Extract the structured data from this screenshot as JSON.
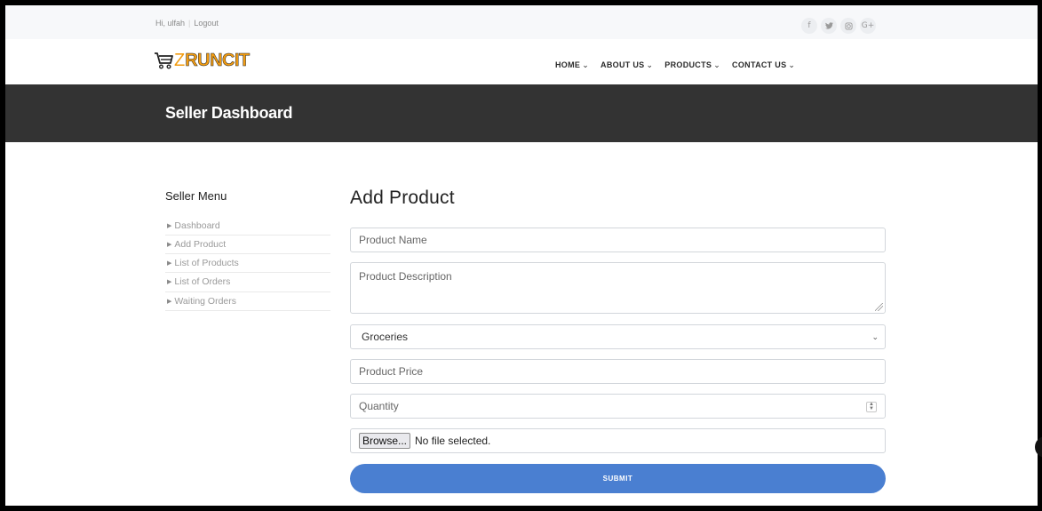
{
  "topbar": {
    "greeting": "Hi, ulfah",
    "separator": "|",
    "logout": "Logout",
    "social": [
      {
        "icon": "facebook-icon",
        "glyph": "f"
      },
      {
        "icon": "twitter-icon",
        "glyph": "❧"
      },
      {
        "icon": "instagram-icon",
        "glyph": "◎"
      },
      {
        "icon": "google-plus-icon",
        "glyph": "G+"
      }
    ]
  },
  "brand": {
    "prefix": "Z",
    "name": "RUNCIT",
    "accent": "#f29c11"
  },
  "nav": {
    "items": [
      {
        "label": "HOME"
      },
      {
        "label": "ABOUT US"
      },
      {
        "label": "PRODUCTS"
      },
      {
        "label": "CONTACT US"
      }
    ],
    "chevron": "⌄"
  },
  "banner": {
    "title": "Seller Dashboard",
    "background": "#333333"
  },
  "sidebar": {
    "title": "Seller Menu",
    "items": [
      {
        "label": "Dashboard"
      },
      {
        "label": "Add Product"
      },
      {
        "label": "List of Products"
      },
      {
        "label": "List of Orders"
      },
      {
        "label": "Waiting Orders"
      }
    ]
  },
  "form": {
    "heading": "Add Product",
    "product_name_placeholder": "Product Name",
    "product_description_placeholder": "Product Description",
    "category_selected": "Groceries",
    "price_placeholder": "Product Price",
    "quantity_placeholder": "Quantity",
    "browse_label": "Browse...",
    "file_status": "No file selected.",
    "submit_label": "SUBMIT",
    "submit_color": "#4a7fd1"
  }
}
